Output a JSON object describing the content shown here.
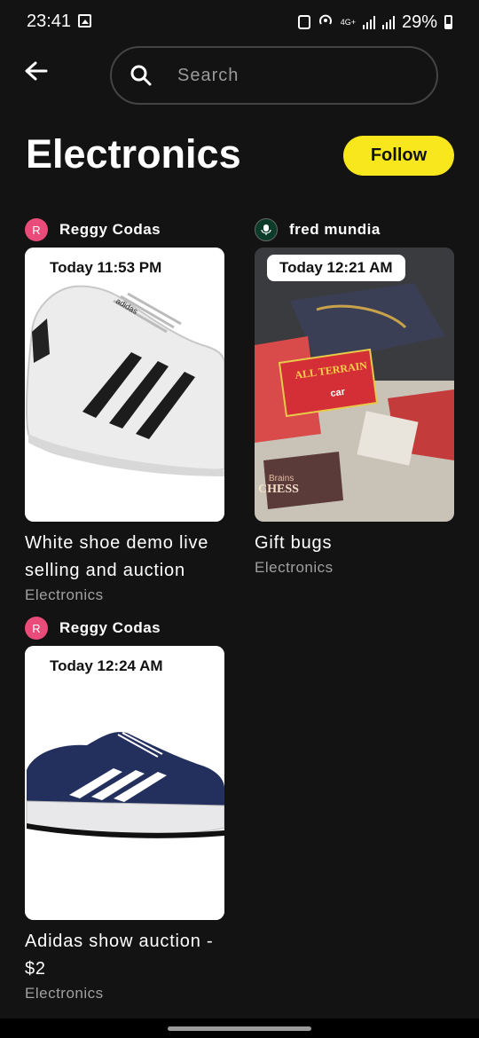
{
  "status_bar": {
    "time": "23:41",
    "network": "4G+",
    "battery": "29%"
  },
  "search": {
    "placeholder": "Search"
  },
  "header": {
    "title": "Electronics",
    "follow_label": "Follow"
  },
  "listings": [
    {
      "seller": "Reggy Codas",
      "avatar_letter": "R",
      "time": "Today 11:53 PM",
      "title": "White shoe demo live selling and auction",
      "category": "Electronics",
      "image": "white-sneaker-image"
    },
    {
      "seller": "fred mundia",
      "avatar_letter": "",
      "time": "Today 12:21 AM",
      "title": "Gift bugs",
      "category": "Electronics",
      "image": "gift-items-image",
      "image_text": {
        "line1": "ALL TERRAIN",
        "line2": "car",
        "line3": "Brains",
        "line4": "CHESS"
      }
    },
    {
      "seller": "Reggy Codas",
      "avatar_letter": "R",
      "time": "Today 12:24 AM",
      "title": "Adidas show auction - $2",
      "category": "Electronics",
      "image": "navy-sneaker-image"
    }
  ]
}
